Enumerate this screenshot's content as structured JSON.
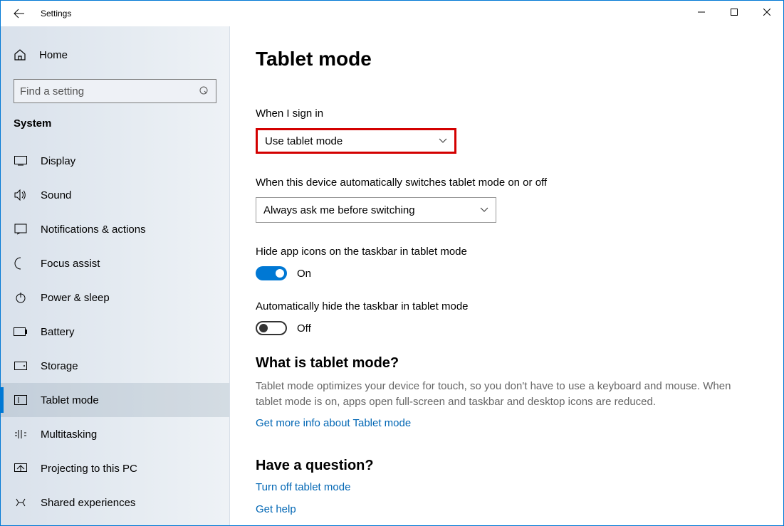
{
  "window": {
    "title": "Settings"
  },
  "sidebar": {
    "home": "Home",
    "search_placeholder": "Find a setting",
    "category": "System",
    "items": [
      {
        "label": "Display"
      },
      {
        "label": "Sound"
      },
      {
        "label": "Notifications & actions"
      },
      {
        "label": "Focus assist"
      },
      {
        "label": "Power & sleep"
      },
      {
        "label": "Battery"
      },
      {
        "label": "Storage"
      },
      {
        "label": "Tablet mode"
      },
      {
        "label": "Multitasking"
      },
      {
        "label": "Projecting to this PC"
      },
      {
        "label": "Shared experiences"
      }
    ]
  },
  "main": {
    "heading": "Tablet mode",
    "sign_in_label": "When I sign in",
    "sign_in_value": "Use tablet mode",
    "auto_switch_label": "When this device automatically switches tablet mode on or off",
    "auto_switch_value": "Always ask me before switching",
    "hide_icons_label": "Hide app icons on the taskbar in tablet mode",
    "hide_icons_state": "On",
    "auto_hide_label": "Automatically hide the taskbar in tablet mode",
    "auto_hide_state": "Off",
    "info_heading": "What is tablet mode?",
    "info_desc": "Tablet mode optimizes your device for touch, so you don't have to use a keyboard and mouse. When tablet mode is on, apps open full-screen and taskbar and desktop icons are reduced.",
    "info_link": "Get more info about Tablet mode",
    "question_heading": "Have a question?",
    "question_links": [
      "Turn off tablet mode",
      "Get help"
    ]
  }
}
